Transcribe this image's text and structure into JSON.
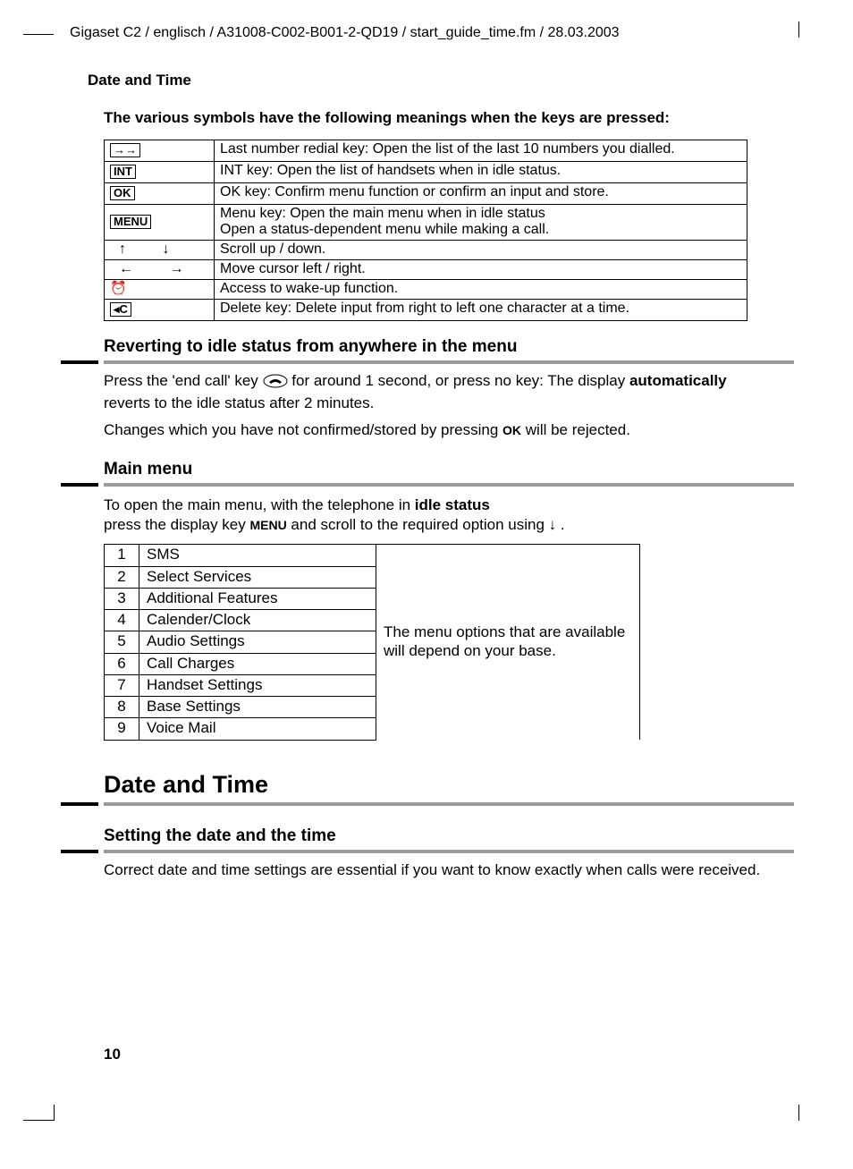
{
  "header_path": "Gigaset C2 / englisch / A31008-C002-B001-2-QD19 / start_guide_time.fm / 28.03.2003",
  "running_head": "Date and Time",
  "symbols_intro": "The various symbols have the following meanings when the keys are pressed:",
  "symbols": [
    {
      "key_label": "→→",
      "key_name": "redial-key-icon",
      "desc": "Last number redial key: Open the list of the last 10 numbers you dialled."
    },
    {
      "key_label": "INT",
      "key_name": "int-key-icon",
      "desc": "INT key: Open the list of handsets when in idle status."
    },
    {
      "key_label": "OK",
      "key_name": "ok-key-icon",
      "desc": "OK key: Confirm menu function or confirm an input and store."
    },
    {
      "key_label": "MENU",
      "key_name": "menu-key-icon",
      "desc": "Menu key: Open the main menu when in idle status\nOpen a status-dependent menu while making a call."
    },
    {
      "key_label": "↑  ↓",
      "key_name": "scroll-updown-icon",
      "desc": "Scroll up / down."
    },
    {
      "key_label": "←  →",
      "key_name": "move-leftright-icon",
      "desc": "Move cursor left / right."
    },
    {
      "key_label": "⏰",
      "key_name": "alarm-icon",
      "desc": "Access to wake-up function."
    },
    {
      "key_label": "◂C",
      "key_name": "delete-key-icon",
      "desc": "Delete key: Delete input from right to left one character at a time."
    }
  ],
  "revert": {
    "heading": "Reverting to idle status from anywhere in the menu",
    "p1_a": "Press the 'end call' key ",
    "p1_b": " for around 1 second, or press no key: The display ",
    "p1_bold": "automatically",
    "p1_c": " reverts to the idle status after 2 minutes.",
    "p2_a": "Changes which you have not confirmed/stored by pressing ",
    "p2_key": "OK",
    "p2_b": " will be rejected."
  },
  "mainmenu": {
    "heading": "Main menu",
    "intro_a": "To open the main menu, with the telephone in ",
    "intro_bold": "idle status",
    "intro_b": "press the display key ",
    "intro_key": "MENU",
    "intro_c": " and scroll to the required option using ",
    "intro_arrow": "↓",
    "intro_d": " .",
    "note": "The menu options that are available will depend on your base.",
    "items": [
      {
        "n": "1",
        "name": "SMS"
      },
      {
        "n": "2",
        "name": "Select Services"
      },
      {
        "n": "3",
        "name": "Additional Features"
      },
      {
        "n": "4",
        "name": "Calender/Clock"
      },
      {
        "n": "5",
        "name": "Audio Settings"
      },
      {
        "n": "6",
        "name": "Call Charges"
      },
      {
        "n": "7",
        "name": "Handset Settings"
      },
      {
        "n": "8",
        "name": "Base Settings"
      },
      {
        "n": "9",
        "name": "Voice Mail"
      }
    ]
  },
  "date_time": {
    "heading": "Date and Time",
    "sub": "Setting the date and the time",
    "para": "Correct date and time settings are essential if you want to know exactly when calls were received."
  },
  "page_number": "10"
}
